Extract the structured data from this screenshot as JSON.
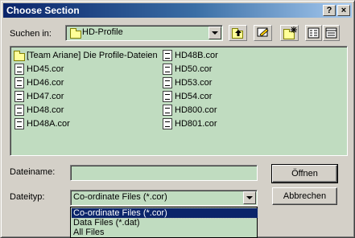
{
  "window": {
    "title": "Choose Section",
    "help_button": "?",
    "close_button": "×"
  },
  "lookin": {
    "label": "Suchen in:",
    "value": "HD-Profile"
  },
  "toolbar": {
    "up_icon": "folder-up-icon",
    "desktop_icon": "desktop-icon",
    "newfolder_icon": "new-folder-icon",
    "list_icon": "list-view-icon",
    "details_icon": "details-view-icon"
  },
  "files": {
    "col1": [
      {
        "name": "[Team Ariane] Die Profile-Dateien",
        "type": "folder"
      },
      {
        "name": "HD45.cor",
        "type": "file"
      },
      {
        "name": "HD46.cor",
        "type": "file"
      },
      {
        "name": "HD47.cor",
        "type": "file"
      },
      {
        "name": "HD48.cor",
        "type": "file"
      },
      {
        "name": "HD48A.cor",
        "type": "file"
      }
    ],
    "col2": [
      {
        "name": "HD48B.cor",
        "type": "file"
      },
      {
        "name": "HD50.cor",
        "type": "file"
      },
      {
        "name": "HD53.cor",
        "type": "file"
      },
      {
        "name": "HD54.cor",
        "type": "file"
      },
      {
        "name": "HD800.cor",
        "type": "file"
      },
      {
        "name": "HD801.cor",
        "type": "file"
      }
    ]
  },
  "filename": {
    "label": "Dateiname:",
    "value": ""
  },
  "filetype": {
    "label": "Dateityp:",
    "value": "Co-ordinate Files (*.cor)",
    "options": [
      "Co-ordinate Files (*.cor)",
      "Data Files (*.dat)",
      "All Files"
    ]
  },
  "buttons": {
    "open": "Öffnen",
    "cancel": "Abbrechen"
  },
  "colors": {
    "panel_bg": "#c0dcc0",
    "dialog_bg": "#d4d0c8",
    "title_start": "#0a246a",
    "selection": "#0a246a"
  }
}
